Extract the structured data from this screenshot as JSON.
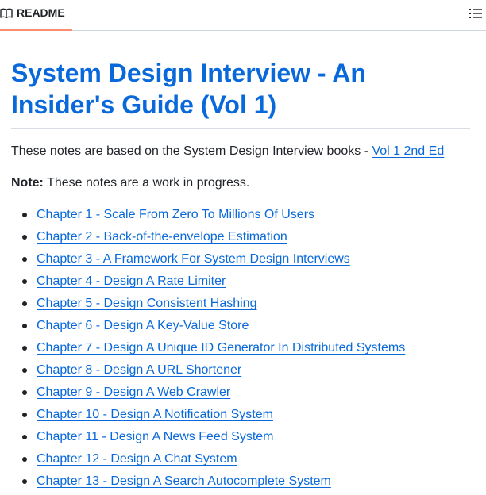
{
  "tab": {
    "label": "README",
    "icon": "book-icon"
  },
  "toc_icon": "list-icon",
  "title": "System Design Interview - An Insider's Guide (Vol 1)",
  "intro": {
    "text": "These notes are based on the System Design Interview books - ",
    "link": "Vol 1 2nd Ed"
  },
  "note": {
    "label": "Note:",
    "text": " These notes are a work in progress."
  },
  "chapters": [
    "Chapter 1 - Scale From Zero To Millions Of Users",
    "Chapter 2 - Back-of-the-envelope Estimation",
    "Chapter 3 - A Framework For System Design Interviews",
    "Chapter 4 - Design A Rate Limiter",
    "Chapter 5 - Design Consistent Hashing",
    "Chapter 6 - Design A Key-Value Store",
    "Chapter 7 - Design A Unique ID Generator In Distributed Systems",
    "Chapter 8 - Design A URL Shortener",
    "Chapter 9 - Design A Web Crawler",
    "Chapter 10 - Design A Notification System",
    "Chapter 11 - Design A News Feed System",
    "Chapter 12 - Design A Chat System",
    "Chapter 13 - Design A Search Autocomplete System"
  ],
  "colors": {
    "link": "#0969da",
    "tab_underline": "#fd8c73"
  }
}
